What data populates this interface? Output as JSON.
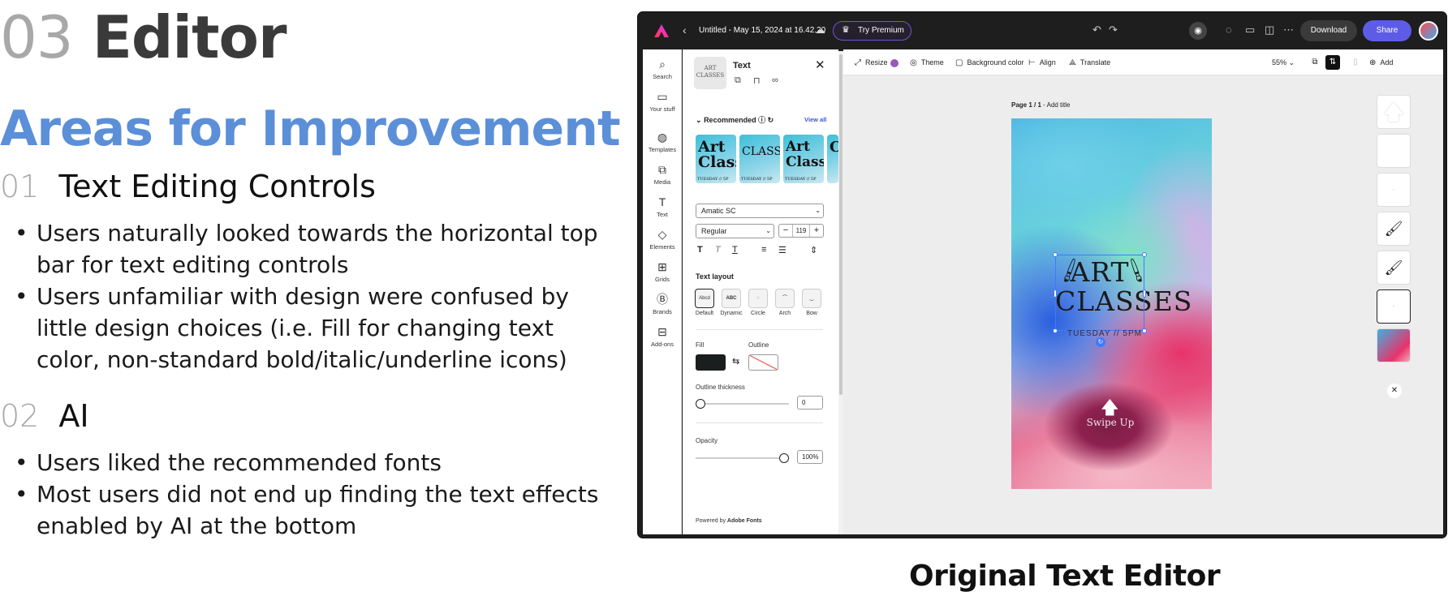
{
  "slide": {
    "section_num": "03",
    "section_title": "Editor",
    "subtitle": "Areas for Improvement",
    "sub1_num": "01",
    "sub1_title": "Text Editing Controls",
    "sub1_bullets": [
      "Users naturally looked towards the horizontal top bar for text editing controls",
      "Users unfamiliar with design were confused by little design choices (i.e. Fill for changing text color, non-standard bold/italic/underline icons)"
    ],
    "sub2_num": "02",
    "sub2_title": "AI",
    "sub2_bullets": [
      "Users liked the recommended fonts",
      "Most users did not end up finding the text effects enabled by AI at the bottom"
    ],
    "caption": "Original Text Editor"
  },
  "app": {
    "doc_title": "Untitled - May 15, 2024 at 16.42.20",
    "try_premium": "Try Premium",
    "download": "Download",
    "share": "Share",
    "rail": [
      "Search",
      "Your stuff",
      "Templates",
      "Media",
      "Text",
      "Elements",
      "Grids",
      "Brands",
      "Add-ons"
    ],
    "toolbar": {
      "resize": "Resize",
      "theme": "Theme",
      "background_color": "Background color",
      "align": "Align",
      "translate": "Translate",
      "zoom": "55%",
      "add": "Add"
    },
    "panel": {
      "title": "Text",
      "thumb_text": "ART CLASSES",
      "recommended": "Recommended",
      "view_all": "View all",
      "font_cards": [
        {
          "t1": "Art Class",
          "t2": "TUESDAY // 5P"
        },
        {
          "t1": "CLASSE",
          "t2": "TUESDAY // 5P"
        },
        {
          "t1": "Art Classes",
          "t2": "TUESDAY // 5P"
        },
        {
          "t1": "Cla",
          "t2": ""
        }
      ],
      "font_name": "Amatic SC",
      "font_style": "Regular",
      "font_size": "119",
      "text_layout": "Text layout",
      "layouts": [
        "Default",
        "Dynamic",
        "Circle",
        "Arch",
        "Bow"
      ],
      "layout_default_sample": "Abcd",
      "layout_dynamic_sample": "ABC",
      "fill": "Fill",
      "outline": "Outline",
      "outline_thickness": "Outline thickness",
      "outline_value": "0",
      "opacity": "Opacity",
      "opacity_value": "100%",
      "opacity_level": 1.0,
      "outline_level": 0.0,
      "powered_prefix": "Powered by",
      "powered_brand": "Adobe Fonts"
    },
    "canvas": {
      "page_label_bold": "Page 1 / 1",
      "page_label_rest": "- Add title",
      "art_text": "ART CLASSES",
      "tuesday": "TUESDAY // 5PM",
      "swipe": "Swipe Up"
    }
  }
}
